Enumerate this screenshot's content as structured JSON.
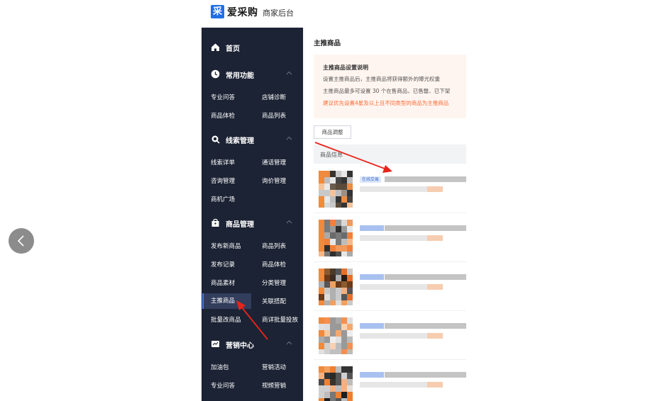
{
  "header": {
    "logo_char": "采",
    "brand": "爱采购",
    "subtitle": "商家后台"
  },
  "sidebar": {
    "home": "首页",
    "sections": [
      {
        "label": "常用功能",
        "icon": "clock-icon",
        "items": [
          "专业问答",
          "店铺诊断",
          "商品体检",
          "商品列表"
        ]
      },
      {
        "label": "线索管理",
        "icon": "search-icon",
        "items": [
          "线索详单",
          "通话管理",
          "咨询管理",
          "询价管理",
          "商机广场"
        ]
      },
      {
        "label": "商品管理",
        "icon": "bag-icon",
        "items": [
          "发布新商品",
          "商品列表",
          "发布记录",
          "商品体检",
          "商品素材",
          "分类管理",
          "主推商品",
          "关联搭配",
          "批量改商品",
          "商详批量投放"
        ]
      },
      {
        "label": "营销中心",
        "icon": "chart-icon",
        "items": [
          "加油包",
          "营销活动",
          "专业问答",
          "视频营销"
        ]
      }
    ],
    "active_item": "主推商品"
  },
  "main": {
    "title": "主推商品",
    "notice": {
      "title": "主推商品设置说明",
      "line1": "设置主推商品后，主推商品将获得额外的曝光权重",
      "line2": "主推商品最多可设置 30 个在售商品，已售罄、已下架",
      "line3": "建议优先设置4星及以上且不同类型的商品为主推商品"
    },
    "adjust_button": "商品调整",
    "table_header": "商品信息",
    "first_tag": "在线交易"
  },
  "colors": {
    "sidebar_bg": "#1c2334",
    "active_bg": "#333d5c",
    "accent": "#4a78e8",
    "warn": "#ff6a33",
    "annotation_arrow": "#e8241a"
  }
}
